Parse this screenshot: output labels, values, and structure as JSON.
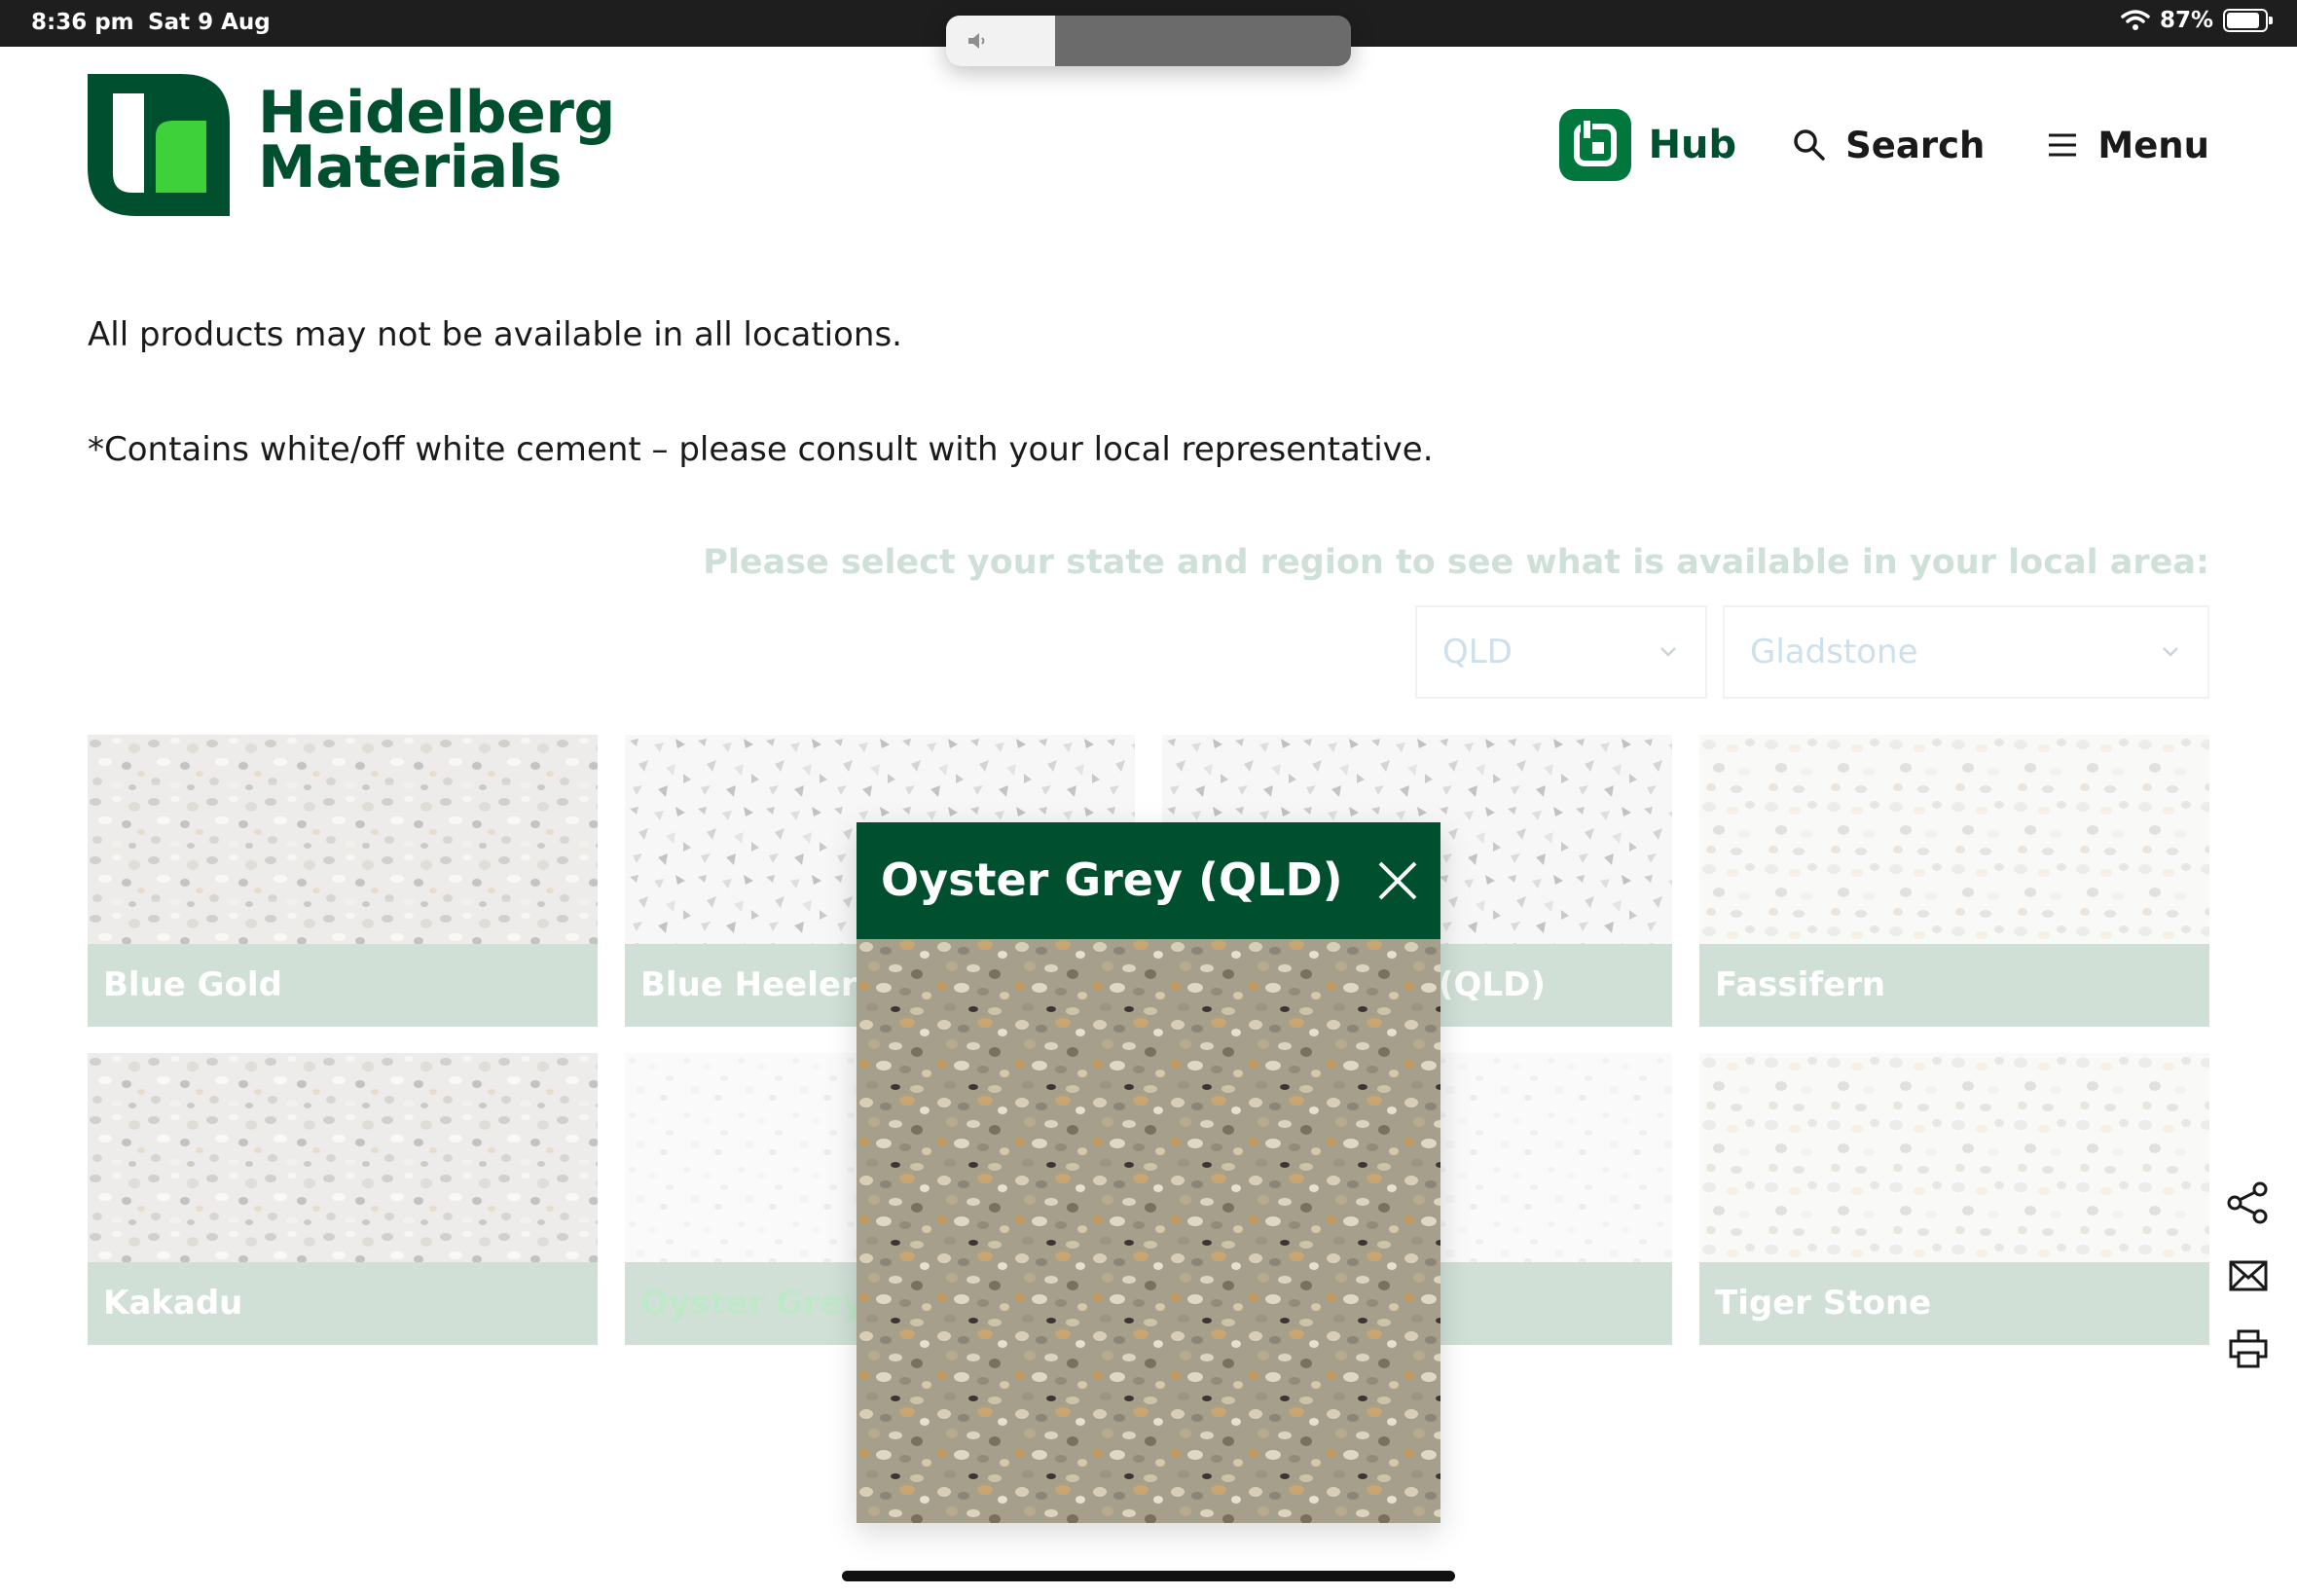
{
  "status_bar": {
    "time": "8:36 pm",
    "date": "Sat 9 Aug",
    "battery": "87%",
    "battery_level": 0.87,
    "volume_level": 0.27
  },
  "header": {
    "brand_line1": "Heidelberg",
    "brand_line2": "Materials",
    "nav": {
      "hub": "Hub",
      "search": "Search",
      "menu": "Menu"
    }
  },
  "content": {
    "availability_note": "All products may not be available in all locations.",
    "cement_note": "*Contains white/off white cement – please consult with your local representative.",
    "filter_prompt": "Please select your state and region to see what is available in your local area:",
    "state_select": "QLD",
    "region_select": "Gladstone"
  },
  "products": [
    {
      "name": "Blue Gold"
    },
    {
      "name": "Blue Heeler ("
    },
    {
      "name": "(QLD)"
    },
    {
      "name": "Fassifern"
    },
    {
      "name": "Kakadu"
    },
    {
      "name": "Oyster Grey"
    },
    {
      "name": ""
    },
    {
      "name": "Tiger Stone"
    }
  ],
  "modal": {
    "title": "Oyster Grey (QLD)"
  },
  "colors": {
    "brand_green": "#00502f",
    "accent_green": "#00773c",
    "label_green": "#d0e0d7"
  },
  "icons": {
    "side_tools": [
      "share-icon",
      "email-icon",
      "print-icon"
    ]
  }
}
